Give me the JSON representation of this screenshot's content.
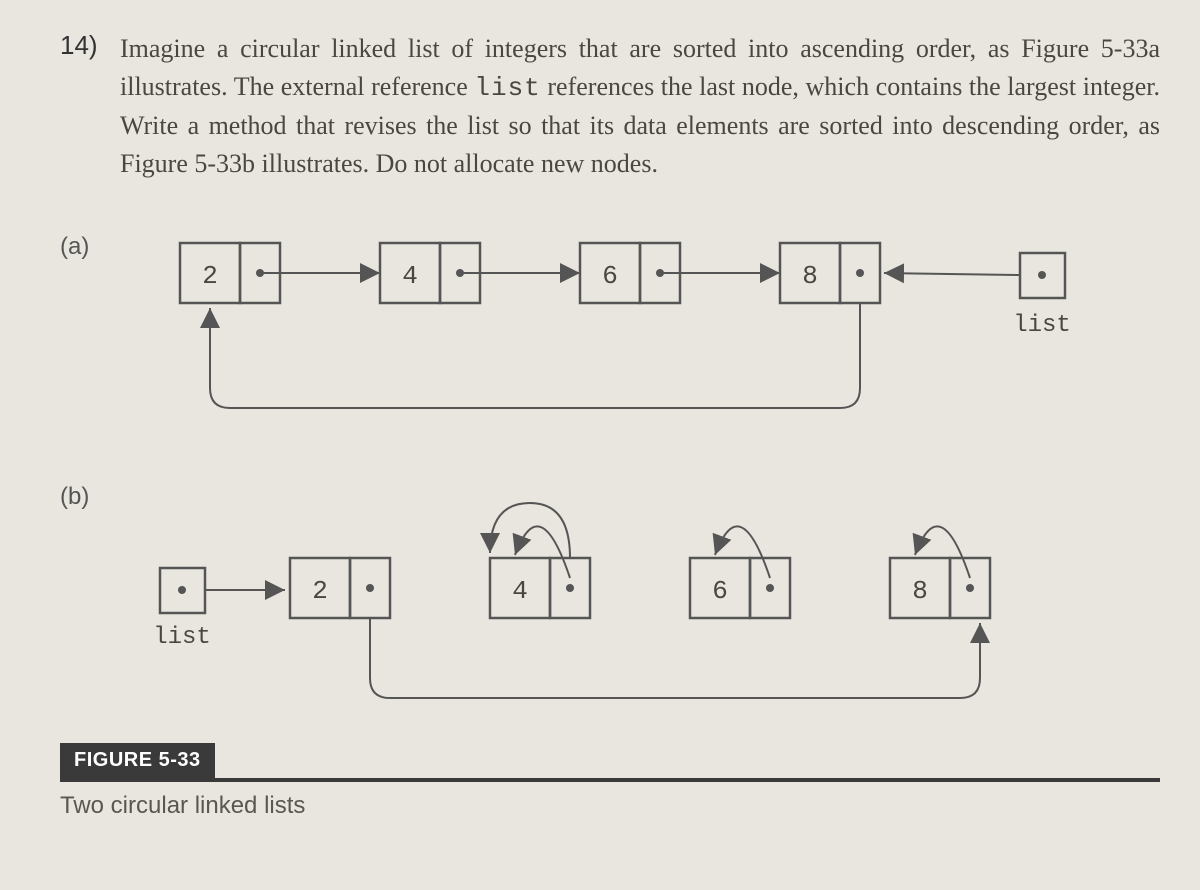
{
  "question": {
    "number": "14)",
    "text_before_code": "Imagine a circular linked list of integers that are sorted into ascending order, as Figure 5-33a illustrates. The external reference ",
    "code_word": "list",
    "text_after_code": " references the last node, which contains the largest integer. Write a method that revises the list so that its data elements are sorted into descending order, as Figure 5-33b illustrates. Do not allocate new nodes."
  },
  "figure": {
    "parts": {
      "a": {
        "label": "(a)",
        "nodes": [
          "2",
          "4",
          "6",
          "8"
        ],
        "ref_label": "list"
      },
      "b": {
        "label": "(b)",
        "nodes": [
          "2",
          "4",
          "6",
          "8"
        ],
        "ref_label": "list"
      }
    },
    "label": "FIGURE 5-33",
    "caption": "Two circular linked lists"
  }
}
